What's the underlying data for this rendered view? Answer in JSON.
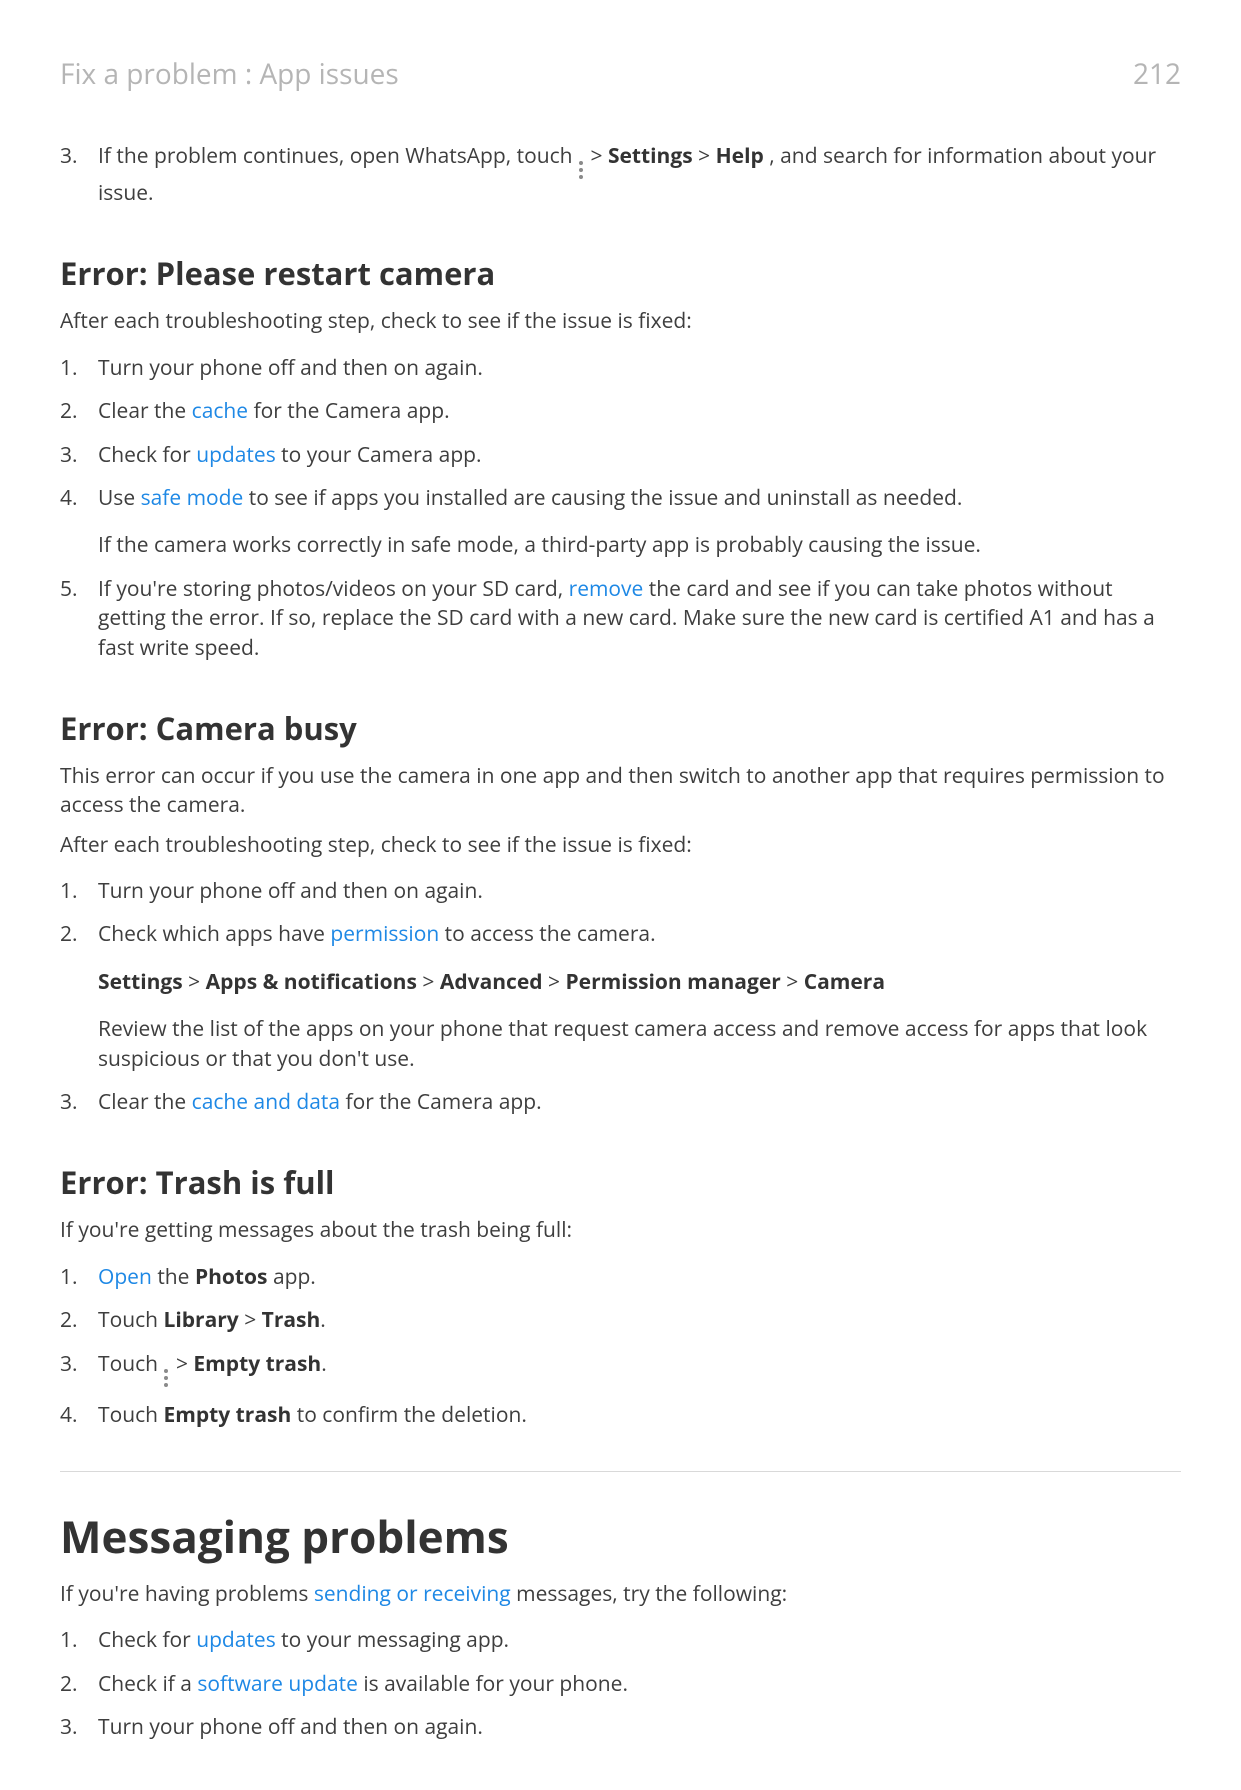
{
  "header": {
    "breadcrumb": "Fix a problem : App issues",
    "page_number": "212"
  },
  "continuation": {
    "num": "3.",
    "prefix": "If the problem continues, open WhatsApp, touch ",
    "sep1": " > ",
    "w1": "Settings",
    "sep2": " > ",
    "w2": "Help",
    "suffix": ", and search for information about your issue."
  },
  "sec_restart": {
    "title": "Error: Please restart camera",
    "intro": "After each troubleshooting step, check to see if the issue is fixed:",
    "items": [
      {
        "num": "1.",
        "text": "Turn your phone off and then on again."
      },
      {
        "num": "2.",
        "pre": "Clear the ",
        "link": "cache",
        "post": " for the Camera app."
      },
      {
        "num": "3.",
        "pre": "Check for ",
        "link": "updates",
        "post": " to your Camera app."
      },
      {
        "num": "4.",
        "pre": "Use ",
        "link": "safe mode",
        "post": " to see if apps you installed are causing the issue and uninstall as needed.",
        "sub": "If the camera works correctly in safe mode, a third-party app is probably causing the issue."
      },
      {
        "num": "5.",
        "pre": "If you're storing photos/videos on your SD card, ",
        "link": "remove",
        "post": " the card and see if you can take photos without getting the error. If so, replace the SD card with a new card. Make sure the new card is certified A1 and has a fast write speed."
      }
    ]
  },
  "sec_busy": {
    "title": "Error: Camera busy",
    "intro1": "This error can occur if you use the camera in one app and then switch to another app that requires permission to access the camera.",
    "intro2": "After each troubleshooting step, check to see if the issue is fixed:",
    "item1": {
      "num": "1.",
      "text": "Turn your phone off and then on again."
    },
    "item2": {
      "num": "2.",
      "pre": "Check which apps have ",
      "link": "permission",
      "post": " to access the camera.",
      "path_settings": "Settings",
      "sep": " > ",
      "p1": "Apps & notifications",
      "p2": "Advanced",
      "p3": "Permission manager",
      "p4": "Camera",
      "review": "Review the list of the apps on your phone that request camera access and remove access for apps that look suspicious or that you don't use."
    },
    "item3": {
      "num": "3.",
      "pre": "Clear the ",
      "link": "cache and data",
      "post": " for the Camera app."
    }
  },
  "sec_trash": {
    "title": "Error: Trash is full",
    "intro": "If you're getting messages about the trash being full:",
    "item1": {
      "num": "1.",
      "link": "Open",
      "mid": " the ",
      "bold": "Photos",
      "post": " app."
    },
    "item2": {
      "num": "2.",
      "pre": "Touch ",
      "b1": "Library",
      "sep": " > ",
      "b2": "Trash",
      "post": "."
    },
    "item3": {
      "num": "3.",
      "pre": "Touch ",
      "sep": " > ",
      "b1": "Empty trash",
      "post": "."
    },
    "item4": {
      "num": "4.",
      "pre": "Touch ",
      "b1": "Empty trash",
      "post": " to confirm the deletion."
    }
  },
  "sec_msg": {
    "title": "Messaging problems",
    "intro_pre": "If you're having problems ",
    "intro_link": "sending or receiving",
    "intro_post": " messages, try the following:",
    "items": [
      {
        "num": "1.",
        "pre": "Check for ",
        "link": "updates",
        "post": " to your messaging app."
      },
      {
        "num": "2.",
        "pre": "Check if a ",
        "link": "software update",
        "post": " is available for your phone."
      },
      {
        "num": "3.",
        "text": "Turn your phone off and then on again."
      }
    ]
  }
}
